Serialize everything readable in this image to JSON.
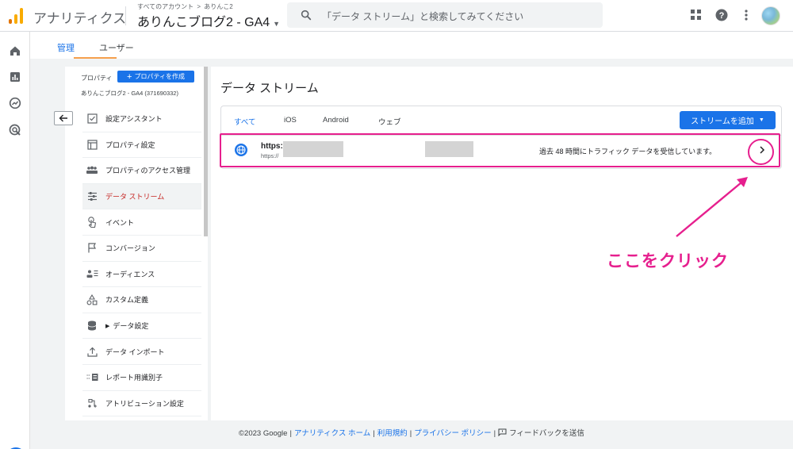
{
  "topbar": {
    "app_name": "アナリティクス",
    "breadcrumb_all": "すべてのアカウント",
    "breadcrumb_sep": ">",
    "breadcrumb_account": "ありんこ2",
    "property_name": "ありんこブログ2 - GA4",
    "search_placeholder": "「データ ストリーム」と検索してみてください",
    "icons": [
      "apps-grid-icon",
      "help-icon",
      "more-vert-icon",
      "account-avatar"
    ]
  },
  "rail": {
    "icons": [
      "home-icon",
      "reports-icon",
      "explore-icon",
      "advertising-icon"
    ],
    "settings_icon": "settings-gear-icon"
  },
  "admin_tabs": [
    "管理",
    "ユーザー"
  ],
  "property_column": {
    "label": "プロパティ",
    "create_button": "プロパティを作成",
    "property_sub": "ありんこブログ2 - GA4 (371690332)",
    "menu": [
      {
        "label": "設定アシスタント",
        "icon": "checkbox-icon",
        "active": false
      },
      {
        "label": "プロパティ設定",
        "icon": "layout-icon",
        "active": false
      },
      {
        "label": "プロパティのアクセス管理",
        "icon": "people-icon",
        "active": false
      },
      {
        "label": "データ ストリーム",
        "icon": "streams-icon",
        "active": true
      },
      {
        "label": "イベント",
        "icon": "touch-icon",
        "active": false
      },
      {
        "label": "コンバージョン",
        "icon": "flag-icon",
        "active": false
      },
      {
        "label": "オーディエンス",
        "icon": "audience-icon",
        "active": false
      },
      {
        "label": "カスタム定義",
        "icon": "shapes-icon",
        "active": false
      },
      {
        "label": "データ設定",
        "icon": "database-icon",
        "active": false
      },
      {
        "label": "データ インポート",
        "icon": "upload-icon",
        "active": false
      },
      {
        "label": "レポート用識別子",
        "icon": "identifier-icon",
        "active": false
      },
      {
        "label": "アトリビューション設定",
        "icon": "attribution-icon",
        "active": false
      }
    ]
  },
  "main": {
    "title": "データ ストリーム",
    "tabs": [
      "すべて",
      "iOS",
      "Android",
      "ウェブ"
    ],
    "active_tab": "すべて",
    "add_stream_button": "ストリームを追加",
    "stream": {
      "url": "https:/",
      "url_sub": "https://",
      "status": "過去 48 時間にトラフィック データを受信しています。"
    }
  },
  "annotation": {
    "text": "ここをクリック",
    "color": "#e61f8e"
  },
  "footer": {
    "copyright": "©2023 Google",
    "home": "アナリティクス ホーム",
    "terms": "利用規約",
    "privacy": "プライバシー ポリシー",
    "feedback": "フィードバックを送信"
  },
  "colors": {
    "accent": "#1a73e8",
    "active_menu_text": "#c5221f",
    "tab_underline": "#f6a04d"
  }
}
